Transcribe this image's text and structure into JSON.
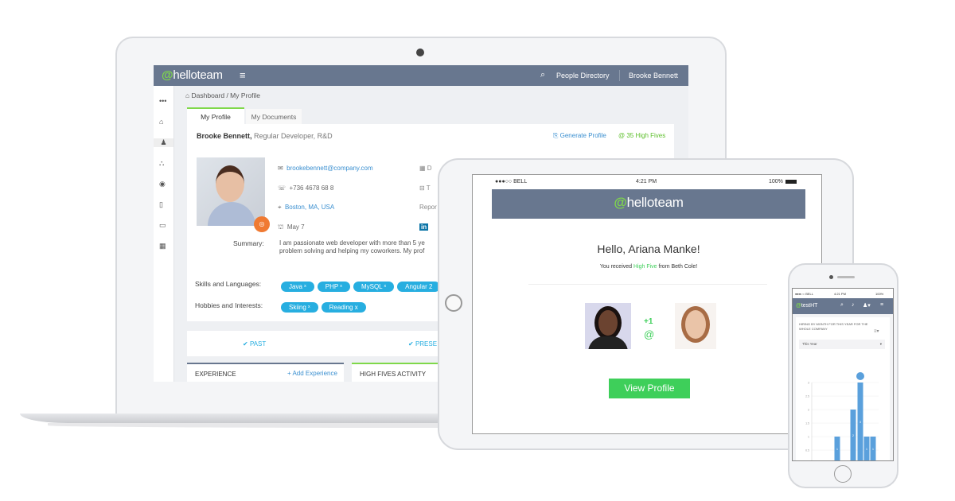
{
  "laptop": {
    "app_name": "helloteam",
    "menu_icon": "hamburger-icon",
    "search_label": "People Directory",
    "user_name": "Brooke Bennett",
    "breadcrumb": "Dashboard / My Profile",
    "tabs": [
      {
        "label": "My Profile",
        "active": true
      },
      {
        "label": "My Documents",
        "active": false
      }
    ],
    "profile": {
      "name": "Brooke Bennett,",
      "role": "Regular Developer, R&D",
      "generate_label": "Generate Profile",
      "high_fives": "35 High Fives",
      "email": "brookebennett@company.com",
      "phone": "+736 4678 68 8",
      "location": "Boston, MA, USA",
      "birthday": "May 7",
      "col2_label1": "D",
      "col2_label2": "T",
      "reports_label": "Repor",
      "summary_label": "Summary:",
      "summary_line1": "I am passionate web developer with more than 5 ye",
      "summary_line2": "problem solving and helping my coworkers. My prof",
      "skills_label": "Skills and Languages:",
      "skills": [
        "Java",
        "PHP",
        "MySQL",
        "Angular 2"
      ],
      "hobbies_label": "Hobbies and Interests:",
      "hobbies": [
        "Skiing",
        "Reading"
      ]
    },
    "timeline": {
      "past": "PAST",
      "present": "PRESE"
    },
    "experience_title": "EXPERIENCE",
    "add_experience": "+ Add Experience",
    "high_fives_activity": "HIGH FIVES ACTIVITY",
    "accent": "#7fd84a",
    "header_color": "#68778f",
    "tag_color": "#27aee0"
  },
  "tablet": {
    "carrier": "●●●○○ BELL",
    "time": "4:21 PM",
    "battery": "100%",
    "app_name": "helloteam",
    "greeting": "Hello, Ariana Manke!",
    "msg_prefix": "You received",
    "msg_highlight": "High Five",
    "msg_suffix": "from Beth Cole!",
    "plus_one": "+1",
    "button": "View Profile",
    "button_color": "#3ecf5a"
  },
  "phone": {
    "carrier": "●●●○○ BELL",
    "time": "4:21 PM",
    "battery": "100%",
    "app_name": "testHT",
    "chart_title": "HIRING BY MONTH FOR THIS YEAR FOR THE WHOLE COMPANY",
    "filter": "This Year"
  },
  "chart_data": {
    "type": "bar",
    "title": "HIRING BY MONTH FOR THIS YEAR FOR THE WHOLE COMPANY",
    "y_ticks": [
      "0.5",
      "1",
      "1.5",
      "2",
      "2.5",
      "3"
    ],
    "ylim": [
      0,
      3
    ],
    "values": [
      1,
      2,
      3,
      1,
      1
    ],
    "labels": [
      "1",
      "2",
      "3",
      "1",
      "1"
    ],
    "bar_color": "#5aa0dc"
  }
}
